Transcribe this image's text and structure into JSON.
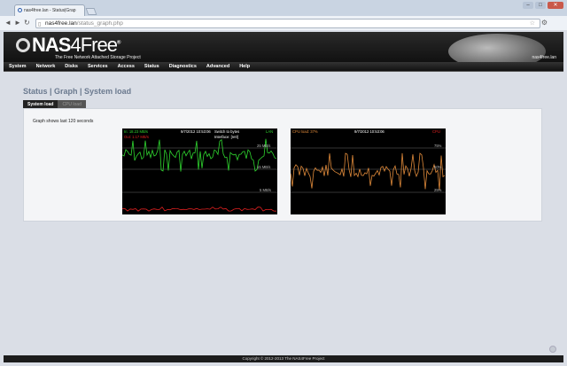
{
  "browser": {
    "tab_title": "nas4free.lan - Status|Grap",
    "url_host": "nas4free.lan",
    "url_path": "/status_graph.php",
    "window_buttons": [
      "–",
      "□",
      "✕"
    ],
    "icons": {
      "back": "back-arrow-icon",
      "forward": "forward-arrow-icon",
      "reload": "reload-icon",
      "star": "star-icon",
      "wrench": "wrench-icon"
    }
  },
  "header": {
    "logo_nas": "NAS",
    "logo_four": "4Free",
    "logo_tm": "®",
    "tagline": "The Free Network Attached Storage Project",
    "hostname": "nas4free.lan"
  },
  "menu": [
    "System",
    "Network",
    "Disks",
    "Services",
    "Access",
    "Status",
    "Diagnostics",
    "Advanced",
    "Help"
  ],
  "page": {
    "title": "Status | Graph | System load",
    "tabs": [
      {
        "label": "System load",
        "active": true
      },
      {
        "label": "CPU load",
        "active": false
      }
    ],
    "note": "Graph shows last 120 seconds"
  },
  "graph_network": {
    "in_label": "In: 18.23 MB/s",
    "out_label": "Out: 1.17 MB/s",
    "timestamp": "9/7/2012 10:53:06",
    "switch_label": "Switch to bytes",
    "interface_label": "Interface: [re0]",
    "lan_label": "LAN",
    "scale_high": "25 MB/s",
    "scale_mid": "15 MB/s",
    "scale_low": "5 MB/s",
    "colors": {
      "in": "#2fd62f",
      "out": "#e02020"
    }
  },
  "graph_cpu": {
    "cpu_label": "CPU load: 37%",
    "timestamp": "9/7/2012 10:53:06",
    "cpu_short": "CPU",
    "scale_high": "75%",
    "scale_mid": "50%",
    "scale_low": "25%",
    "colors": {
      "line": "#e08a3a"
    }
  },
  "footer": "Copyright © 2012-2013 The NAS4Free Project"
}
